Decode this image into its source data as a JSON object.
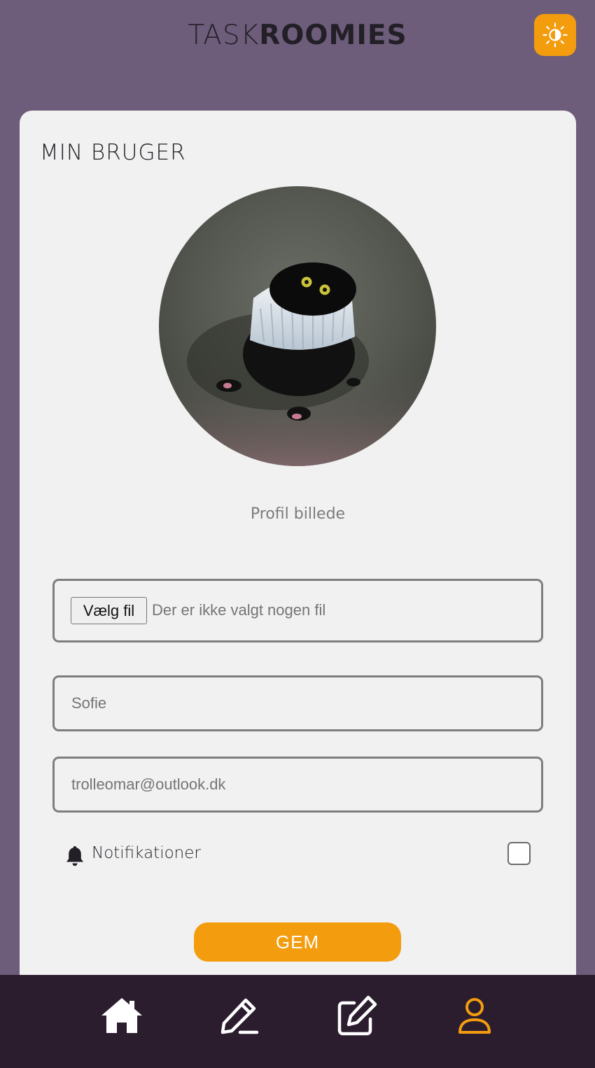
{
  "header": {
    "logo_light": "TASK",
    "logo_bold": "ROOMIES",
    "theme_icon": "sun-icon"
  },
  "card": {
    "title": "MIN BRUGER",
    "avatar_caption": "Profil billede"
  },
  "form": {
    "file_button": "Vælg fil",
    "file_status": "Der er ikke valgt nogen fil",
    "name_placeholder": "Sofie",
    "email_placeholder": "trolleomar@outlook.dk",
    "notifications_label": "Notifikationer",
    "notifications_checked": false,
    "save_label": "GEM"
  },
  "nav": {
    "items": [
      "home-icon",
      "pencil-icon",
      "edit-square-icon",
      "user-icon"
    ],
    "active": "user-icon"
  },
  "colors": {
    "background": "#6d5d7b",
    "accent": "#f39c0e",
    "card": "#f1f1f1",
    "nav_background": "#2b1d2e",
    "nav_icon": "#ffffff",
    "nav_active": "#f39c0e"
  }
}
